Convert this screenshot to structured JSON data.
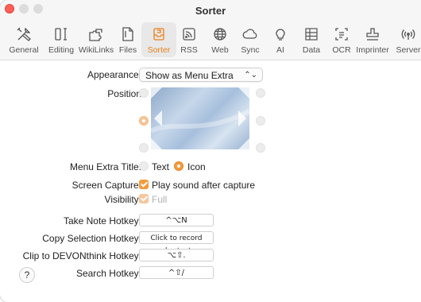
{
  "window": {
    "title": "Sorter"
  },
  "tabs": [
    {
      "label": "General",
      "icon": "tools-icon"
    },
    {
      "label": "Editing",
      "icon": "text-cursor-icon"
    },
    {
      "label": "WikiLinks",
      "icon": "puzzle-icon"
    },
    {
      "label": "Files",
      "icon": "files-icon"
    },
    {
      "label": "Sorter",
      "icon": "sorter-tray-icon",
      "active": true
    },
    {
      "label": "RSS",
      "icon": "rss-icon"
    },
    {
      "label": "Web",
      "icon": "globe-icon"
    },
    {
      "label": "Sync",
      "icon": "cloud-icon"
    },
    {
      "label": "AI",
      "icon": "lightbulb-icon"
    },
    {
      "label": "Data",
      "icon": "data-icon"
    },
    {
      "label": "OCR",
      "icon": "ocr-icon"
    },
    {
      "label": "Imprinter",
      "icon": "stamp-icon"
    },
    {
      "label": "Server",
      "icon": "broadcast-icon"
    }
  ],
  "appearance": {
    "label": "Appearance:",
    "value": "Show as Menu Extra",
    "chevron": "⌃⌄"
  },
  "position": {
    "label": "Position",
    "selected": "left-middle"
  },
  "menu_extra_title": {
    "label": "Menu Extra Title:",
    "option_text": "Text",
    "option_icon": "Icon",
    "selected": "Icon"
  },
  "screen_capture": {
    "label": "Screen Capture:",
    "option": "Play sound after capture",
    "checked": true
  },
  "visibility": {
    "label": "Visibility:",
    "option": "Full",
    "checked": true,
    "disabled": true
  },
  "hotkeys": [
    {
      "label": "Take Note Hotkey:",
      "value": "^⌥N"
    },
    {
      "label": "Copy Selection Hotkey:",
      "value": "Click to record shortcut"
    },
    {
      "label": "Clip to DEVONthink Hotkey:",
      "value": "⌥⇧."
    },
    {
      "label": "Search Hotkey:",
      "value": "^⇧/"
    }
  ],
  "help": {
    "label": "?"
  },
  "colors": {
    "accent": "#f59a3a",
    "close": "#fe5f57"
  }
}
